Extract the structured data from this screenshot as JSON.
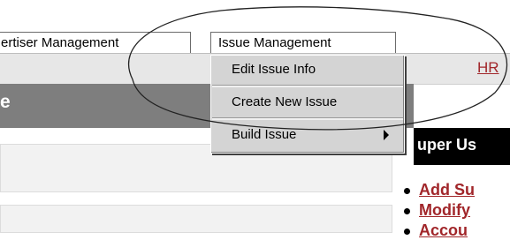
{
  "tabs": {
    "advertiser_label": "ertiser Management",
    "issue_label": "Issue Management"
  },
  "bar": {
    "link_label": "HR"
  },
  "header": {
    "title_fragment": "e"
  },
  "menu": {
    "items": [
      {
        "label": "Edit Issue Info"
      },
      {
        "label": "Create New Issue"
      },
      {
        "label": "Build Issue"
      }
    ]
  },
  "right_panel": {
    "title": "uper Us",
    "links": [
      "Add Su",
      "Modify",
      "Accou"
    ]
  },
  "colors": {
    "link": "#a1262a",
    "menu_bg": "#d4d4d4",
    "header_bg": "#7e7e7e",
    "super_bar_bg": "#000000"
  }
}
